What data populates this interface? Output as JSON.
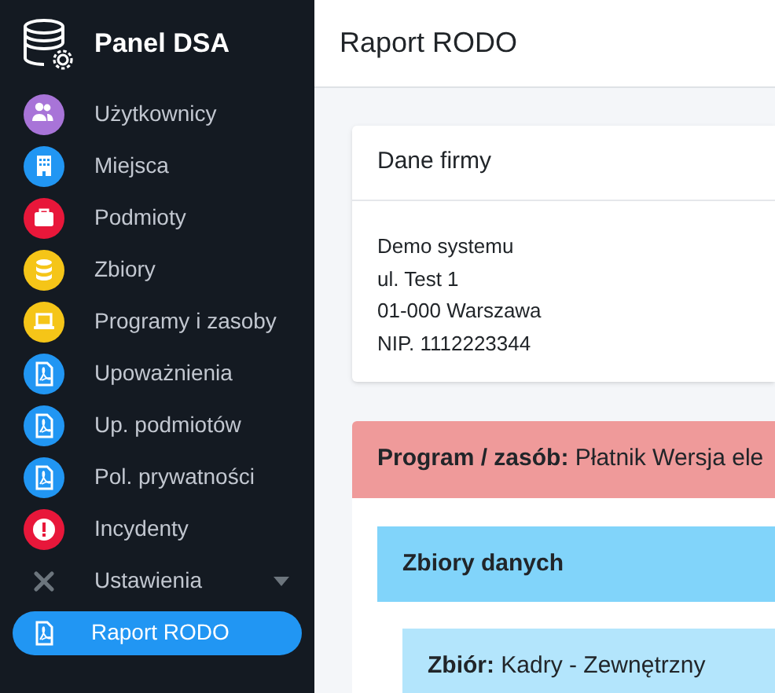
{
  "sidebar": {
    "brand": "Panel DSA",
    "items": [
      {
        "label": "Użytkownicy",
        "kind": "users",
        "color": "#a874d8",
        "selected": false
      },
      {
        "label": "Miejsca",
        "kind": "building",
        "color": "#2196f3",
        "selected": false
      },
      {
        "label": "Podmioty",
        "kind": "briefcase",
        "color": "#e8173a",
        "selected": false
      },
      {
        "label": "Zbiory",
        "kind": "database",
        "color": "#f5c518",
        "selected": false
      },
      {
        "label": "Programy i zasoby",
        "kind": "laptop",
        "color": "#f5c518",
        "selected": false
      },
      {
        "label": "Upoważnienia",
        "kind": "pdf",
        "color": "#2196f3",
        "selected": false
      },
      {
        "label": "Up. podmiotów",
        "kind": "pdf",
        "color": "#2196f3",
        "selected": false
      },
      {
        "label": "Pol. prywatności",
        "kind": "pdf",
        "color": "#2196f3",
        "selected": false
      },
      {
        "label": "Incydenty",
        "kind": "alert",
        "color": "#e8173a",
        "selected": false
      },
      {
        "label": "Ustawienia",
        "kind": "settings",
        "expanded": true,
        "selected": false
      },
      {
        "label": "Raport RODO",
        "kind": "pdf-plain",
        "selected": true
      }
    ]
  },
  "header": {
    "title": "Raport RODO"
  },
  "company_card": {
    "title": "Dane firmy",
    "lines": [
      "Demo systemu",
      "ul. Test 1",
      "01-000 Warszawa",
      "NIP. 1112223344"
    ]
  },
  "program_card": {
    "title": "**Program / zasób:** Płatnik Wersja ele",
    "datasets_card": {
      "title": "Zbiory danych",
      "dataset": {
        "title": "**Zbiór:** Kadry - Zewnętrzny"
      }
    }
  }
}
